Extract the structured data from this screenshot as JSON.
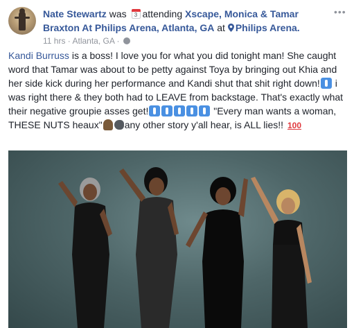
{
  "post": {
    "author": "Nate Stewartz",
    "was": "was",
    "calendar_day": "3",
    "attending": "attending",
    "event": "Xscape, Monica & Tamar Braxton At Philips Arena, Atlanta, GA",
    "at": "at",
    "place": "Philips Arena.",
    "time": "11 hrs",
    "sep": " · ",
    "location": "Atlanta, GA",
    "more": "•••",
    "text": {
      "mention": "Kandi Burruss",
      "p1": " is a boss! I love you for what you did tonight man! She caught word that Tamar was about to be petty against Toya by bringing out Khia and her side kick during her performance and Kandi shut that shit right down!",
      "p2": " i was right there & they both had to LEAVE from backstage. That's exactly what their negative groupie asses get!",
      "p3": " \"Every man wants a woman, THESE NUTS heaux\"",
      "p4": "any other story y'all hear, is ALL lies!! ",
      "emoji_100": "100"
    }
  },
  "icons": [
    "calendar-icon",
    "location-pin-icon",
    "globe-icon",
    "more-options-icon",
    "walking-emoji-icon",
    "man-emoji-icon",
    "speaking-head-emoji-icon",
    "hundred-points-emoji-icon"
  ],
  "colors": {
    "link": "#365899",
    "meta": "#90949c",
    "text": "#1d2129"
  }
}
